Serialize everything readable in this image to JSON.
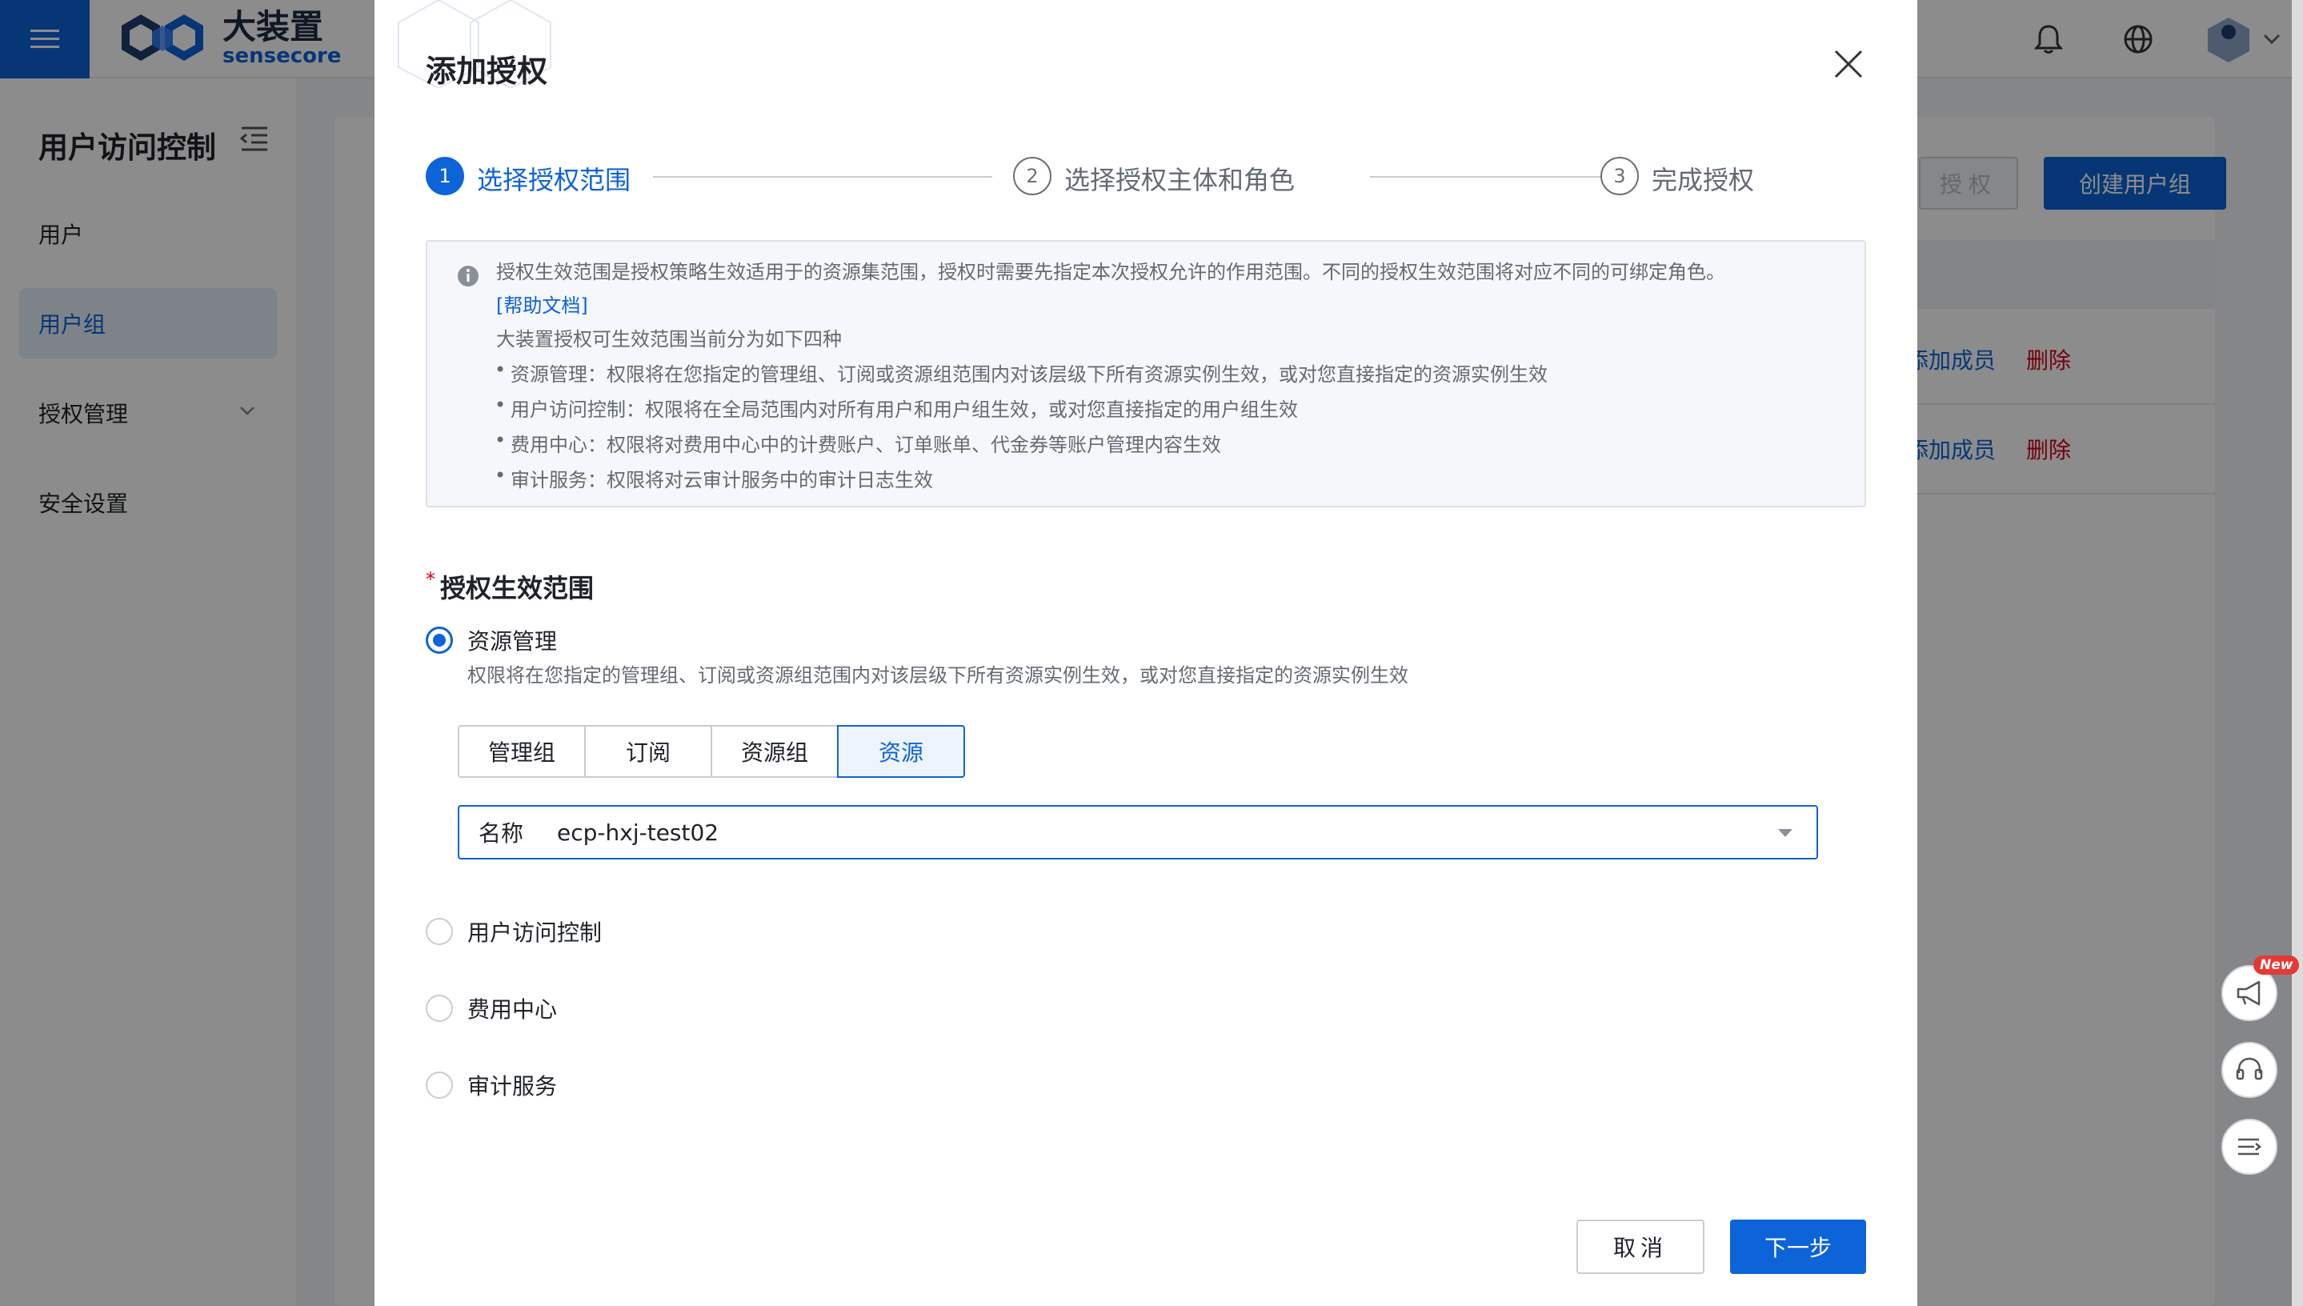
{
  "app": {
    "brand_cn": "大装置",
    "brand_en": "sensecore"
  },
  "sidebar": {
    "title": "用户访问控制",
    "items": [
      {
        "label": "用户"
      },
      {
        "label": "用户组"
      },
      {
        "label": "授权管理"
      },
      {
        "label": "安全设置"
      }
    ]
  },
  "background_page": {
    "auth_button": "授权",
    "create_group_button": "创建用户组",
    "rows": [
      {
        "add_member": "添加成员",
        "delete": "删除"
      },
      {
        "add_member": "添加成员",
        "delete": "删除"
      }
    ],
    "new_badge": "New"
  },
  "modal": {
    "title": "添加授权",
    "steps": [
      {
        "num": "1",
        "label": "选择授权范围"
      },
      {
        "num": "2",
        "label": "选择授权主体和角色"
      },
      {
        "num": "3",
        "label": "完成授权"
      }
    ],
    "info": {
      "line1": "授权生效范围是授权策略生效适用于的资源集范围，授权时需要先指定本次授权允许的作用范围。不同的授权生效范围将对应不同的可绑定角色。",
      "help_link": "[帮助文档]",
      "line2": "大装置授权可生效范围当前分为如下四种",
      "bullets": [
        "资源管理：权限将在您指定的管理组、订阅或资源组范围内对该层级下所有资源实例生效，或对您直接指定的资源实例生效",
        "用户访问控制：权限将在全局范围内对所有用户和用户组生效，或对您直接指定的用户组生效",
        "费用中心：权限将对费用中心中的计费账户、订单账单、代金券等账户管理内容生效",
        "审计服务：权限将对云审计服务中的审计日志生效"
      ]
    },
    "field_label": "授权生效范围",
    "scope_options": [
      {
        "label": "资源管理",
        "checked": true,
        "desc": "权限将在您指定的管理组、订阅或资源组范围内对该层级下所有资源实例生效，或对您直接指定的资源实例生效"
      },
      {
        "label": "用户访问控制",
        "checked": false
      },
      {
        "label": "费用中心",
        "checked": false
      },
      {
        "label": "审计服务",
        "checked": false
      }
    ],
    "resource_tabs": [
      {
        "label": "管理组",
        "active": false
      },
      {
        "label": "订阅",
        "active": false
      },
      {
        "label": "资源组",
        "active": false
      },
      {
        "label": "资源",
        "active": true
      }
    ],
    "select": {
      "label": "名称",
      "value": "ecp-hxj-test02"
    },
    "cancel_button": "取消",
    "next_button": "下一步"
  },
  "colors": {
    "primary": "#0d63d8",
    "danger": "#d0021b"
  }
}
